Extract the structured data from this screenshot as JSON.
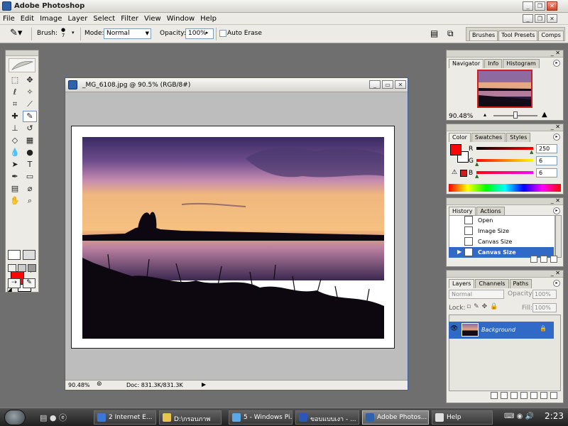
{
  "window": {
    "title": "Adobe Photoshop"
  },
  "menu": [
    "File",
    "Edit",
    "Image",
    "Layer",
    "Select",
    "Filter",
    "View",
    "Window",
    "Help"
  ],
  "options": {
    "brush_label": "Brush:",
    "brush_size": "7",
    "mode_label": "Mode:",
    "mode_value": "Normal",
    "opacity_label": "Opacity:",
    "opacity_value": "100%",
    "auto_erase_label": "Auto Erase"
  },
  "palette_well": {
    "tabs": [
      "Brushes",
      "Tool Presets",
      "Comps"
    ]
  },
  "document": {
    "title": "_MG_6108.jpg @ 90.5% (RGB/8#)",
    "status_zoom": "90.48%",
    "status_doc": "Doc: 831.3K/831.3K"
  },
  "navigator": {
    "tabs": [
      "Navigator",
      "Info",
      "Histogram"
    ],
    "zoom": "90.48%"
  },
  "color": {
    "tabs": [
      "Color",
      "Swatches",
      "Styles"
    ],
    "r_label": "R",
    "r_value": "250",
    "g_label": "G",
    "g_value": "6",
    "b_label": "B",
    "b_value": "6",
    "foreground": "#fa0606"
  },
  "history": {
    "tabs": [
      "History",
      "Actions"
    ],
    "items": [
      "Open",
      "Image Size",
      "Canvas Size",
      "Canvas Size"
    ]
  },
  "layers": {
    "tabs": [
      "Layers",
      "Channels",
      "Paths"
    ],
    "blend_mode": "Normal",
    "opacity_label": "Opacity:",
    "opacity_value": "100%",
    "lock_label": "Lock:",
    "fill_label": "Fill:",
    "fill_value": "100%",
    "layer_name": "Background"
  },
  "taskbar": {
    "items": [
      "2 Internet E...",
      "D:\\กรอบภาพ",
      "5 - Windows Pi...",
      "ขอบแบบเงา - ...",
      "Adobe Photos...",
      "Help"
    ],
    "clock": "2:23"
  }
}
